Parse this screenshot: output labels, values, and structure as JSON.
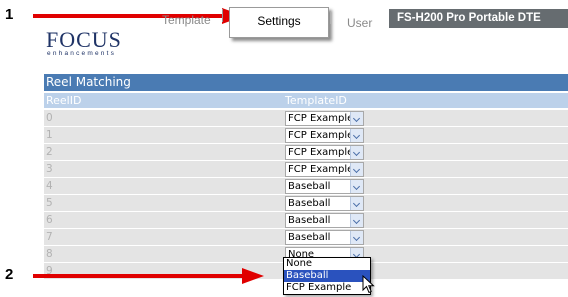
{
  "callouts": [
    "1",
    "2"
  ],
  "logo": {
    "text": "FOCUS",
    "sub": "enhancements"
  },
  "tabs": {
    "template": "Template",
    "settings": "Settings",
    "user": "User"
  },
  "product": "FS-H200 Pro Portable DTE",
  "section": {
    "title": "Reel Matching",
    "col_reel": "ReelID",
    "col_template": "TemplateID"
  },
  "rows": [
    {
      "id": "0",
      "template": "FCP Example"
    },
    {
      "id": "1",
      "template": "FCP Example"
    },
    {
      "id": "2",
      "template": "FCP Example"
    },
    {
      "id": "3",
      "template": "FCP Example"
    },
    {
      "id": "4",
      "template": "Baseball"
    },
    {
      "id": "5",
      "template": "Baseball"
    },
    {
      "id": "6",
      "template": "Baseball"
    },
    {
      "id": "7",
      "template": "Baseball"
    },
    {
      "id": "8",
      "template": "None"
    },
    {
      "id": "9",
      "template": ""
    }
  ],
  "dropdown": {
    "options": [
      "None",
      "Baseball",
      "FCP Example"
    ],
    "highlighted": "Baseball"
  },
  "colors": {
    "arrow": "#e00000",
    "header": "#4a7bb3",
    "product_bar": "#666c70",
    "highlight": "#2a52be"
  }
}
